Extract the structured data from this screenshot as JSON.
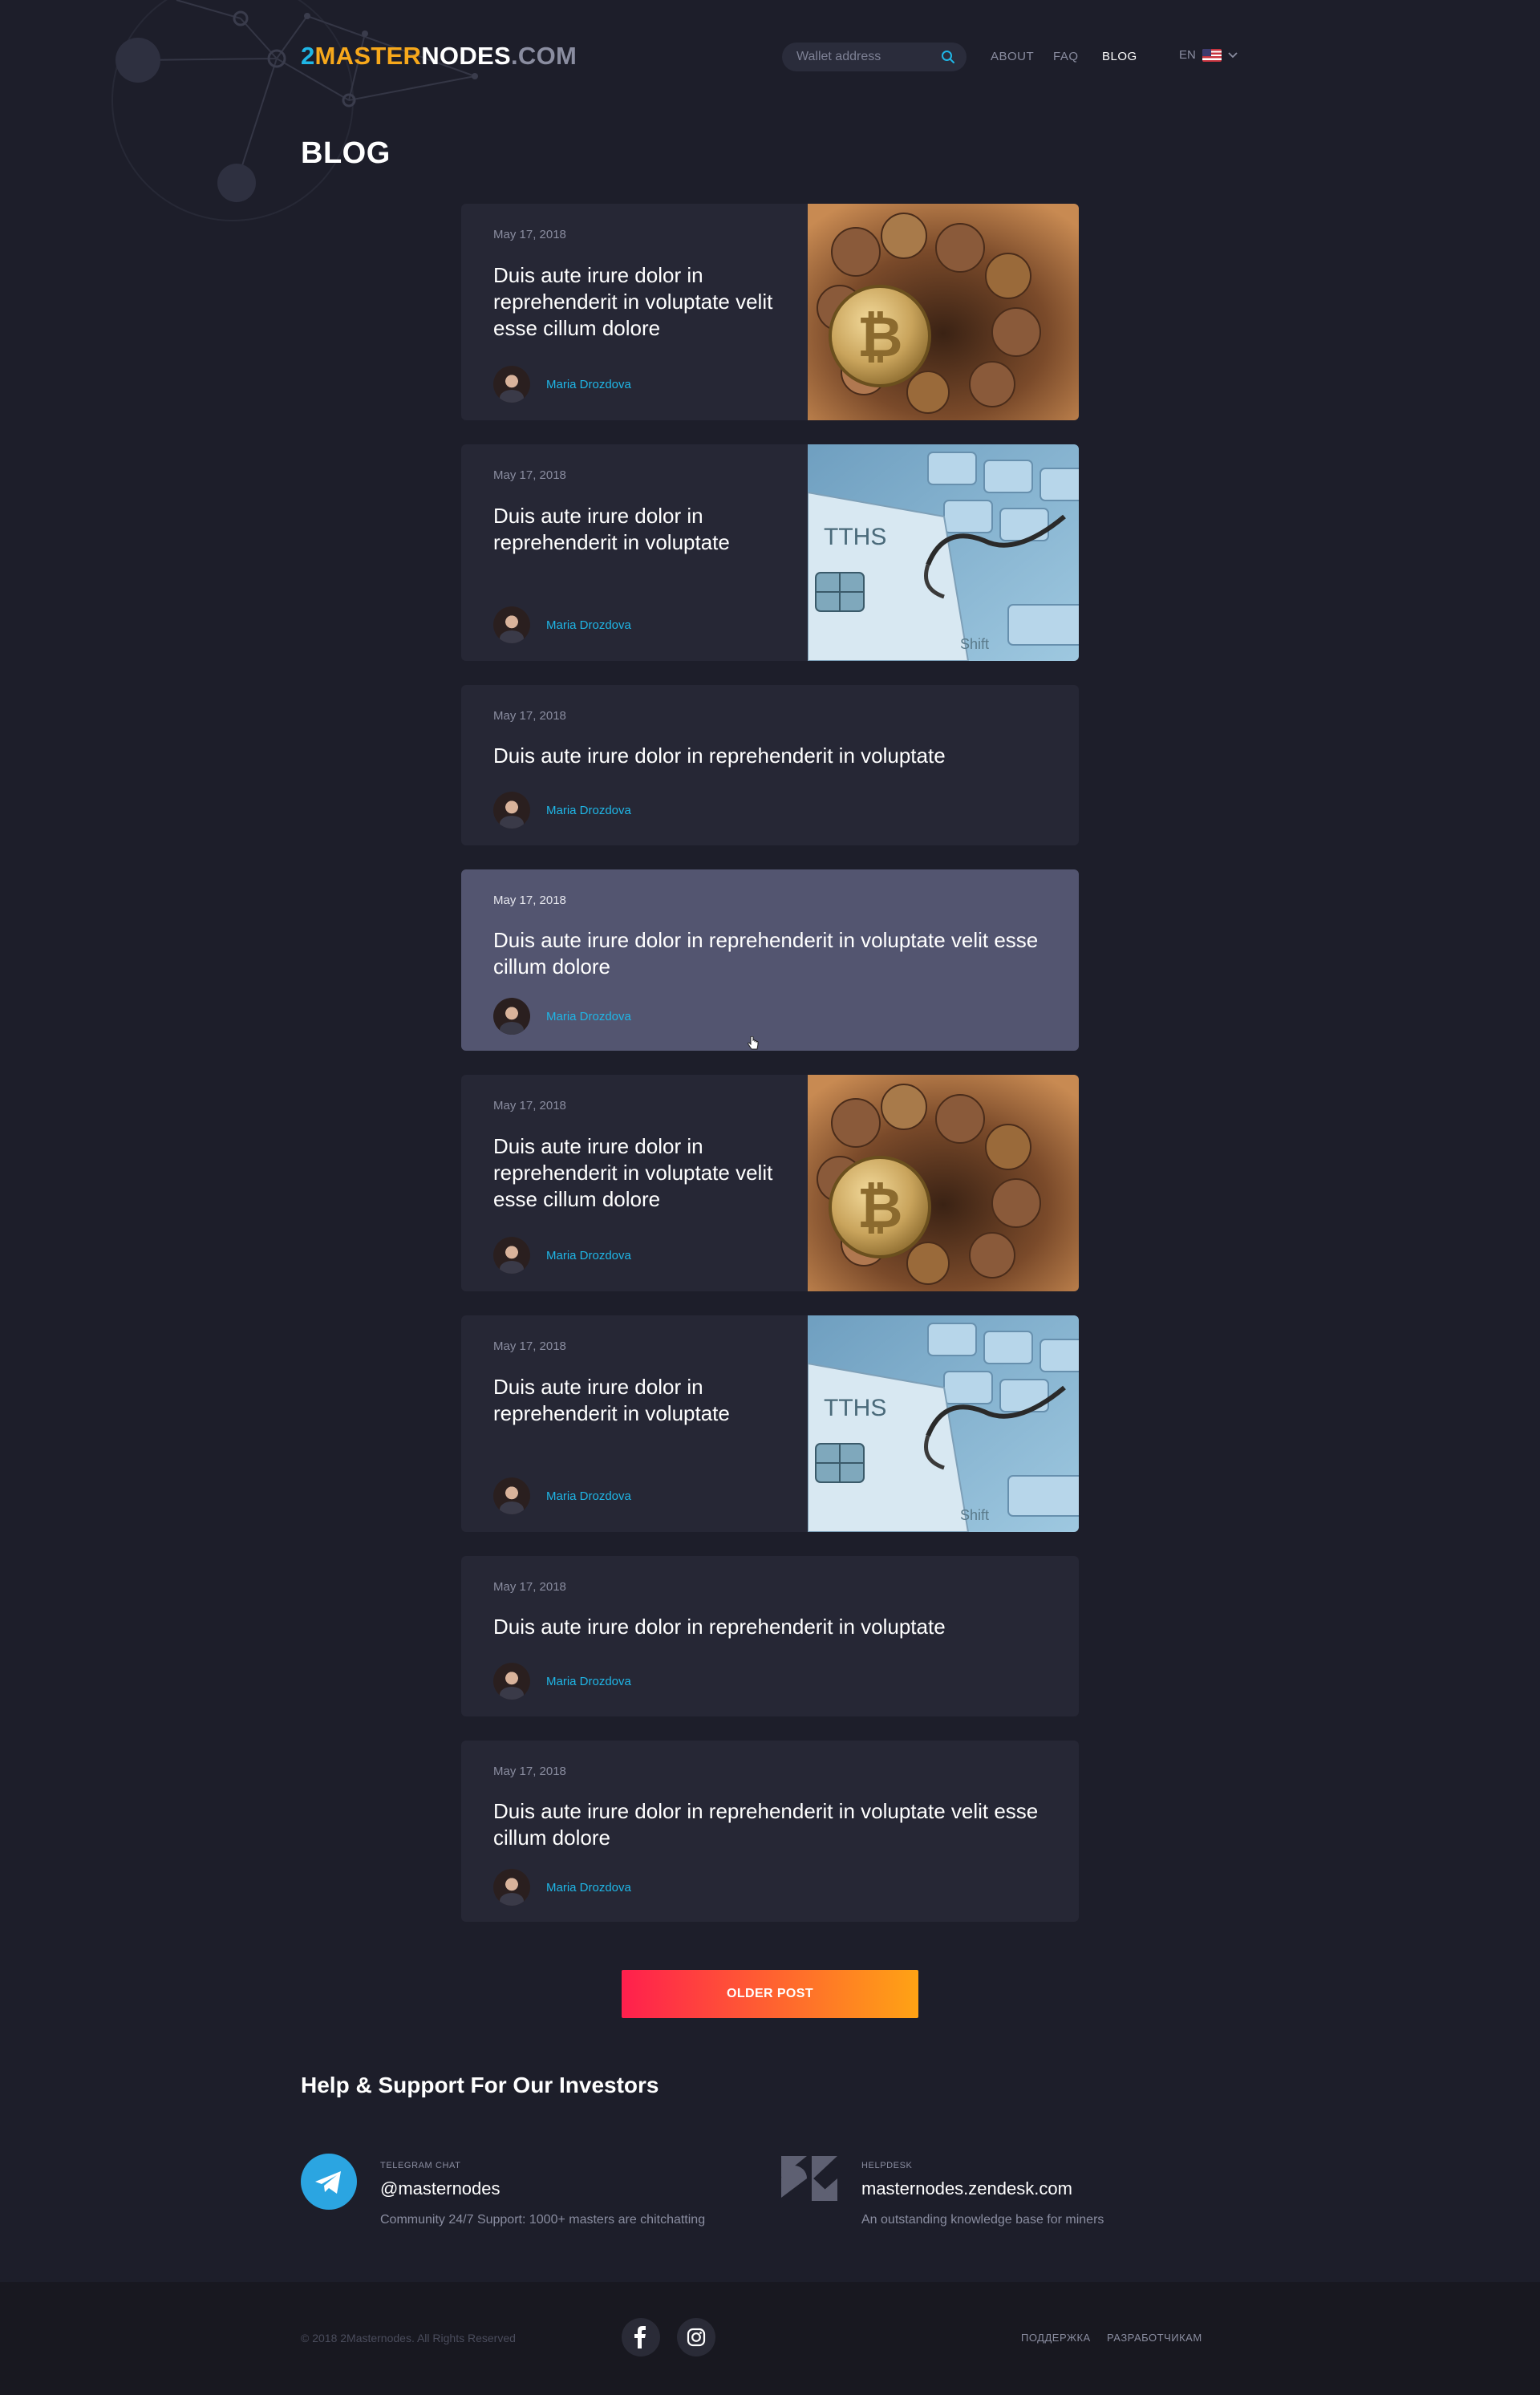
{
  "header": {
    "logo": {
      "part1": "2",
      "part2": "MASTER",
      "part3": "NODES",
      "part4": ".COM"
    },
    "search_placeholder": "Wallet address",
    "nav": [
      {
        "label": "ABOUT"
      },
      {
        "label": "FAQ"
      },
      {
        "label": "BLOG"
      }
    ],
    "language": "EN"
  },
  "page_title": "BLOG",
  "posts": [
    {
      "date": "May 17, 2018",
      "title": "Duis aute irure dolor in reprehenderit in voluptate velit esse cillum dolore",
      "author": "Maria Drozdova",
      "image": "bitcoin-coins"
    },
    {
      "date": "May 17, 2018",
      "title": "Duis aute irure dolor in reprehenderit in voluptate",
      "author": "Maria Drozdova",
      "image": "phishing-card"
    },
    {
      "date": "May 17, 2018",
      "title": "Duis aute irure dolor in reprehenderit in voluptate",
      "author": "Maria Drozdova"
    },
    {
      "date": "May 17, 2018",
      "title": "Duis aute irure dolor in reprehenderit in voluptate velit esse cillum dolore",
      "author": "Maria Drozdova"
    },
    {
      "date": "May 17, 2018",
      "title": "Duis aute irure dolor in reprehenderit in voluptate velit esse cillum dolore",
      "author": "Maria Drozdova",
      "image": "bitcoin-coins"
    },
    {
      "date": "May 17, 2018",
      "title": "Duis aute irure dolor in reprehenderit in voluptate",
      "author": "Maria Drozdova",
      "image": "phishing-card"
    },
    {
      "date": "May 17, 2018",
      "title": "Duis aute irure dolor in reprehenderit in voluptate",
      "author": "Maria Drozdova"
    },
    {
      "date": "May 17, 2018",
      "title": "Duis aute irure dolor in reprehenderit in voluptate velit esse cillum dolore",
      "author": "Maria Drozdova"
    }
  ],
  "older_post_label": "OLDER POST",
  "help": {
    "title": "Help & Support For Our Investors",
    "telegram": {
      "label": "TELEGRAM CHAT",
      "handle": "@masternodes",
      "desc": "Community 24/7 Support: 1000+ masters are chitchatting"
    },
    "helpdesk": {
      "label": "HELPDESK",
      "handle": "masternodes.zendesk.com",
      "desc": "An outstanding knowledge base for miners"
    }
  },
  "footer": {
    "copyright": "© 2018 2Masternodes. All Rights Reserved",
    "links": [
      {
        "label": "ПОДДЕРЖКА"
      },
      {
        "label": "РАЗРАБОТЧИКАМ"
      }
    ]
  },
  "colors": {
    "accent_blue": "#1fb6e6",
    "accent_orange": "#f7a81b",
    "button_start": "#ff1f4d",
    "button_end": "#ffa314",
    "card_bg": "#262735",
    "card_hover_bg": "#535570"
  }
}
